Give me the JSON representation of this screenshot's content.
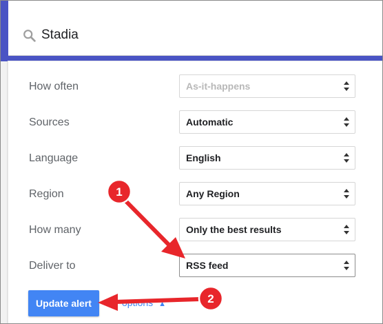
{
  "search": {
    "query": "Stadia"
  },
  "form": {
    "rows": [
      {
        "label": "How often",
        "value": "As-it-happens",
        "disabled": true
      },
      {
        "label": "Sources",
        "value": "Automatic",
        "disabled": false
      },
      {
        "label": "Language",
        "value": "English",
        "disabled": false
      },
      {
        "label": "Region",
        "value": "Any Region",
        "disabled": false
      },
      {
        "label": "How many",
        "value": "Only the best results",
        "disabled": false
      },
      {
        "label": "Deliver to",
        "value": "RSS feed",
        "disabled": false
      }
    ]
  },
  "actions": {
    "update_label": "Update alert",
    "show_options_label": "options"
  },
  "annotations": {
    "badge_1": "1",
    "badge_2": "2",
    "color": "#e8262b"
  },
  "colors": {
    "header": "#4a54c4",
    "button": "#4285f4"
  }
}
